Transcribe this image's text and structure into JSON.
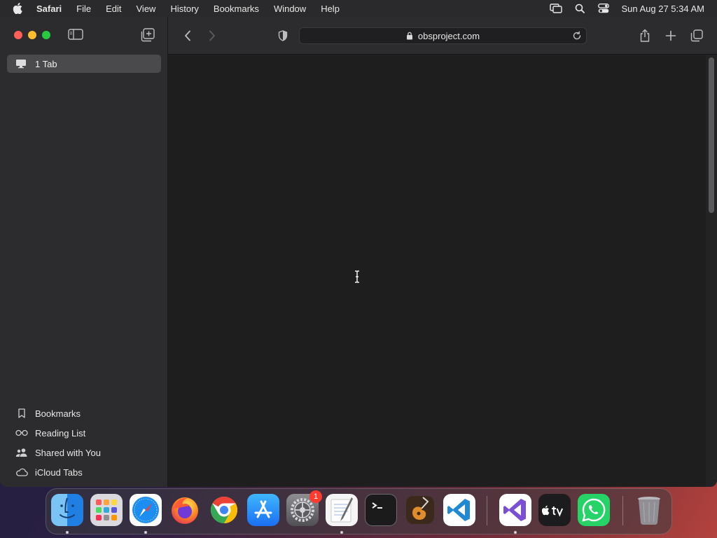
{
  "menubar": {
    "app_name": "Safari",
    "items": [
      "File",
      "Edit",
      "View",
      "History",
      "Bookmarks",
      "Window",
      "Help"
    ],
    "clock": "Sun Aug 27  5:34 AM"
  },
  "sidebar": {
    "tab_row_label": "1 Tab",
    "sections": [
      {
        "label": "Bookmarks",
        "icon": "bookmark-icon"
      },
      {
        "label": "Reading List",
        "icon": "glasses-icon"
      },
      {
        "label": "Shared with You",
        "icon": "people-icon"
      },
      {
        "label": "iCloud Tabs",
        "icon": "cloud-icon"
      }
    ]
  },
  "toolbar": {
    "url": "obsproject.com"
  },
  "dock": {
    "apps": [
      {
        "name": "Finder",
        "icon": "finder-icon"
      },
      {
        "name": "Launchpad",
        "icon": "launchpad-icon"
      },
      {
        "name": "Safari",
        "icon": "safari-icon"
      },
      {
        "name": "Firefox",
        "icon": "firefox-icon"
      },
      {
        "name": "Chrome",
        "icon": "chrome-icon"
      },
      {
        "name": "App Store",
        "icon": "app-store-icon"
      },
      {
        "name": "System Settings",
        "icon": "settings-icon",
        "badge": "1"
      },
      {
        "name": "TextEdit",
        "icon": "textedit-icon"
      },
      {
        "name": "Terminal",
        "icon": "terminal-icon"
      },
      {
        "name": "GarageBand",
        "icon": "garageband-icon"
      },
      {
        "name": "Visual Studio Code",
        "icon": "vscode-icon"
      },
      {
        "name": "Visual Studio",
        "icon": "visual-studio-icon"
      },
      {
        "name": "Apple TV",
        "icon": "apple-tv-icon"
      },
      {
        "name": "WhatsApp",
        "icon": "whatsapp-icon"
      },
      {
        "name": "Trash",
        "icon": "trash-icon"
      }
    ]
  },
  "colors": {
    "close": "#ff5f57",
    "minimize": "#febc2e",
    "maximize": "#28c840",
    "badge": "#ff3b30"
  }
}
